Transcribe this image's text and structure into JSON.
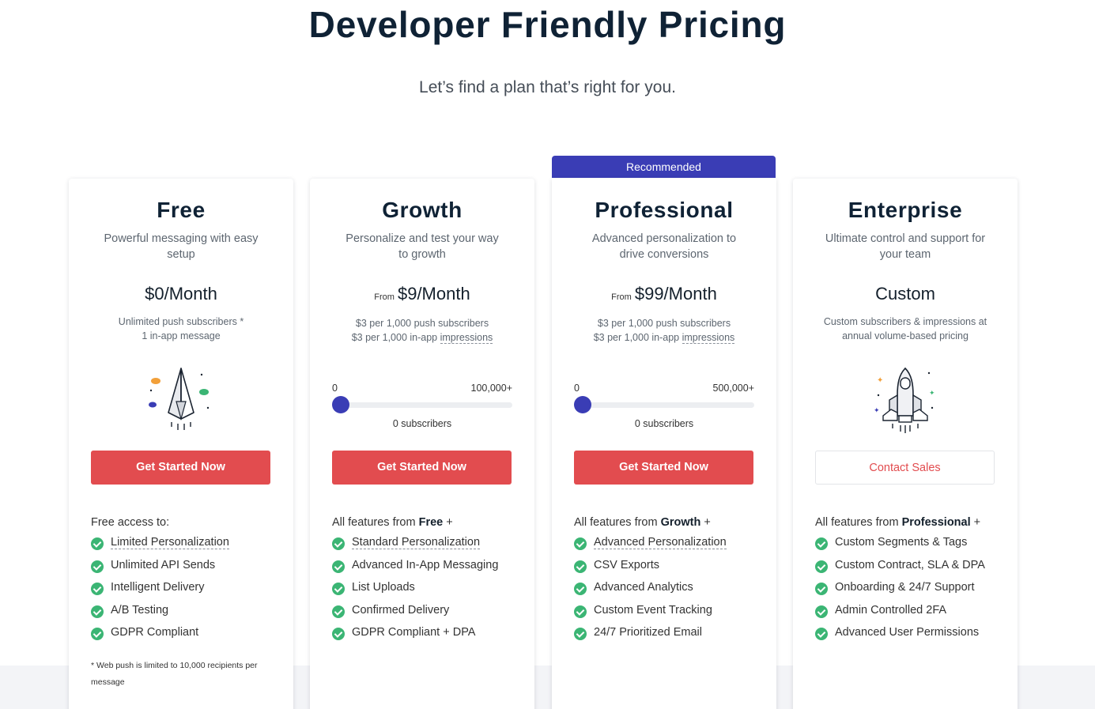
{
  "header": {
    "title": "Developer Friendly Pricing",
    "subtitle": "Let’s find a plan that’s right for you."
  },
  "recommended_label": "Recommended",
  "plans": [
    {
      "name": "Free",
      "description": "Powerful messaging with easy setup",
      "price_from": "",
      "price": "$0/Month",
      "price_note_1": "Unlimited push subscribers *",
      "price_note_2": "1 in-app message",
      "button": "Get Started Now",
      "features_head": "Free access to:",
      "features": [
        "Limited Personalization",
        "Unlimited API Sends",
        "Intelligent Delivery",
        "A/B Testing",
        "GDPR Compliant"
      ],
      "footnote": "* Web push is limited to 10,000 recipients per message",
      "illustration": "paper-plane-icon"
    },
    {
      "name": "Growth",
      "description": "Personalize and test your way to growth",
      "price_from": "From",
      "price": "$9/Month",
      "price_note_1": "$3 per 1,000 push subscribers",
      "price_note_2a": "$3 per 1,000 in-app ",
      "price_note_2b": "impressions",
      "slider": {
        "min": "0",
        "max": "100,000+",
        "value_label": "0 subscribers",
        "position": 0
      },
      "button": "Get Started Now",
      "features_head_pre": "All features from ",
      "features_head_bold": "Free",
      "features_head_post": " +",
      "features": [
        "Standard Personalization",
        "Advanced In-App Messaging",
        "List Uploads",
        "Confirmed Delivery",
        "GDPR Compliant + DPA"
      ]
    },
    {
      "name": "Professional",
      "description": "Advanced personalization to drive conversions",
      "price_from": "From",
      "price": "$99/Month",
      "price_note_1": "$3 per 1,000 push subscribers",
      "price_note_2a": "$3 per 1,000 in-app ",
      "price_note_2b": "impressions",
      "slider": {
        "min": "0",
        "max": "500,000+",
        "value_label": "0 subscribers",
        "position": 0
      },
      "button": "Get Started Now",
      "features_head_pre": "All features from ",
      "features_head_bold": "Growth",
      "features_head_post": " +",
      "features": [
        "Advanced Personalization",
        "CSV Exports",
        "Advanced Analytics",
        "Custom Event Tracking",
        "24/7 Prioritized Email"
      ]
    },
    {
      "name": "Enterprise",
      "description": "Ultimate control and support for your team",
      "price": "Custom",
      "price_note_1": "Custom subscribers & impressions at",
      "price_note_2": "annual volume-based pricing",
      "button": "Contact Sales",
      "features_head_pre": "All features from ",
      "features_head_bold": "Professional",
      "features_head_post": " +",
      "features": [
        "Custom Segments & Tags",
        "Custom Contract, SLA & DPA",
        "Onboarding & 24/7 Support",
        "Admin Controlled 2FA",
        "Advanced User Permissions"
      ],
      "illustration": "rocket-icon"
    }
  ],
  "colors": {
    "accent_blue": "#3a3db5",
    "cta_red": "#e24c4f",
    "check_green": "#3bb574"
  }
}
